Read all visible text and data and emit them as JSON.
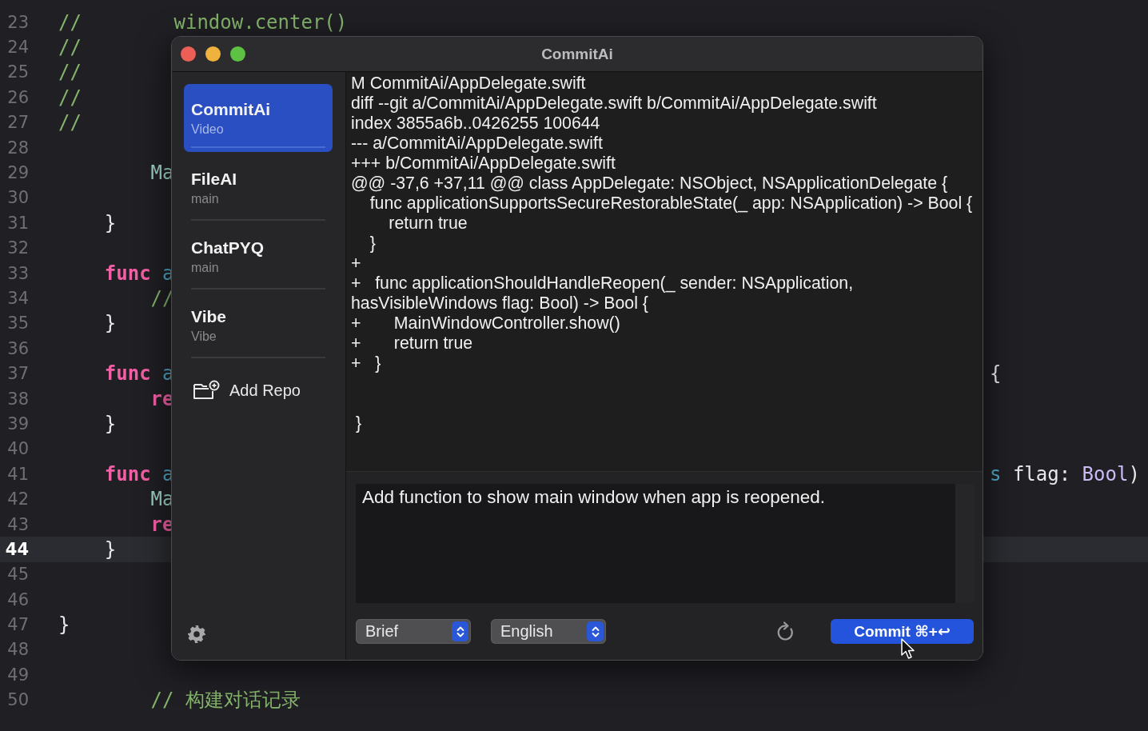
{
  "editor": {
    "lines": [
      {
        "number": "23",
        "current": false,
        "segments": [
          {
            "text": "//",
            "kind": "comment"
          },
          {
            "text": "        window.center()",
            "kind": "comment"
          }
        ]
      },
      {
        "number": "24",
        "current": false,
        "segments": [
          {
            "text": "//",
            "kind": "comment"
          }
        ]
      },
      {
        "number": "25",
        "current": false,
        "segments": [
          {
            "text": "//",
            "kind": "comment"
          }
        ]
      },
      {
        "number": "26",
        "current": false,
        "segments": [
          {
            "text": "//",
            "kind": "comment"
          }
        ]
      },
      {
        "number": "27",
        "current": false,
        "segments": [
          {
            "text": "//",
            "kind": "comment"
          }
        ]
      },
      {
        "number": "28",
        "current": false
      },
      {
        "number": "29",
        "current": false,
        "segments": [
          {
            "text": "        Ma",
            "kind": "type"
          }
        ]
      },
      {
        "number": "30",
        "current": false
      },
      {
        "number": "31",
        "current": false,
        "segments": [
          {
            "text": "    }",
            "kind": "plain"
          }
        ]
      },
      {
        "number": "32",
        "current": false
      },
      {
        "number": "33",
        "current": false,
        "segments": [
          {
            "text": "    func",
            "kind": "keyword"
          },
          {
            "text": " a",
            "kind": "ident"
          }
        ]
      },
      {
        "number": "34",
        "current": false,
        "segments": [
          {
            "text": "        //",
            "kind": "comment"
          }
        ]
      },
      {
        "number": "35",
        "current": false,
        "segments": [
          {
            "text": "    }",
            "kind": "plain"
          }
        ]
      },
      {
        "number": "36",
        "current": false
      },
      {
        "number": "37",
        "current": false,
        "segments": [
          {
            "text": "    func",
            "kind": "keyword"
          },
          {
            "text": " a",
            "kind": "ident"
          }
        ],
        "right": [
          {
            "text": "{",
            "kind": "plain"
          }
        ]
      },
      {
        "number": "38",
        "current": false,
        "segments": [
          {
            "text": "        re",
            "kind": "keyword"
          }
        ]
      },
      {
        "number": "39",
        "current": false,
        "segments": [
          {
            "text": "    }",
            "kind": "plain"
          }
        ]
      },
      {
        "number": "40",
        "current": false
      },
      {
        "number": "41",
        "current": false,
        "segments": [
          {
            "text": "    func",
            "kind": "keyword"
          },
          {
            "text": " a",
            "kind": "ident"
          }
        ],
        "right": [
          {
            "text": "s",
            "kind": "ident"
          },
          {
            "text": " flag:",
            "kind": "plain"
          },
          {
            "text": " Bool",
            "kind": "builtin"
          },
          {
            "text": ")",
            "kind": "plain"
          }
        ]
      },
      {
        "number": "42",
        "current": false,
        "segments": [
          {
            "text": "        Ma",
            "kind": "type"
          }
        ]
      },
      {
        "number": "43",
        "current": false,
        "segments": [
          {
            "text": "        re",
            "kind": "keyword"
          }
        ]
      },
      {
        "number": "44",
        "current": true,
        "segments": [
          {
            "text": "    }",
            "kind": "plain"
          }
        ]
      },
      {
        "number": "45",
        "current": false
      },
      {
        "number": "46",
        "current": false
      },
      {
        "number": "47",
        "current": false,
        "segments": [
          {
            "text": "}",
            "kind": "plain"
          }
        ]
      },
      {
        "number": "48",
        "current": false
      },
      {
        "number": "49",
        "current": false
      },
      {
        "number": "50",
        "current": false,
        "segments": [
          {
            "text": "        // 构建对话记录",
            "kind": "comment"
          }
        ]
      }
    ]
  },
  "window": {
    "title": "CommitAi",
    "sidebar": {
      "repos": [
        {
          "name": "CommitAi",
          "branch": "Video",
          "selected": true
        },
        {
          "name": "FileAI",
          "branch": "main",
          "selected": false
        },
        {
          "name": "ChatPYQ",
          "branch": "main",
          "selected": false
        },
        {
          "name": "Vibe",
          "branch": "Vibe",
          "selected": false
        }
      ],
      "add_repo": "Add Repo"
    },
    "diff": {
      "lines": [
        {
          "kind": "text",
          "text": "M CommitAi/AppDelegate.swift"
        },
        {
          "kind": "text",
          "text": "diff --git a/CommitAi/AppDelegate.swift b/CommitAi/AppDelegate.swift"
        },
        {
          "kind": "text",
          "text": "index 3855a6b..0426255 100644"
        },
        {
          "kind": "text",
          "text": "--- a/CommitAi/AppDelegate.swift"
        },
        {
          "kind": "text",
          "text": "+++ b/CommitAi/AppDelegate.swift"
        },
        {
          "kind": "text",
          "text": "@@ -37,6 +37,11 @@ class AppDelegate: NSObject, NSApplicationDelegate {"
        },
        {
          "kind": "text",
          "text": "    func applicationSupportsSecureRestorableState(_ app: NSApplication) -> Bool {"
        },
        {
          "kind": "text",
          "text": "        return true"
        },
        {
          "kind": "text",
          "text": "    }"
        },
        {
          "kind": "text",
          "text": "+"
        },
        {
          "kind": "text",
          "text": "+   func applicationShouldHandleReopen(_ sender: NSApplication,"
        },
        {
          "kind": "text",
          "text": "hasVisibleWindows flag: Bool) -> Bool {"
        },
        {
          "kind": "text",
          "text": "+       MainWindowController.show()"
        },
        {
          "kind": "text",
          "text": "+       return true"
        },
        {
          "kind": "text",
          "text": "+   }"
        },
        {
          "kind": "blank"
        },
        {
          "kind": "blank"
        },
        {
          "kind": "text",
          "text": " }"
        }
      ]
    },
    "message": {
      "value": "Add function to show main window when app is reopened."
    },
    "style_popup": {
      "value": "Brief"
    },
    "language_popup": {
      "value": "English"
    },
    "commit_button": {
      "label": "Commit ⌘+↩"
    }
  }
}
